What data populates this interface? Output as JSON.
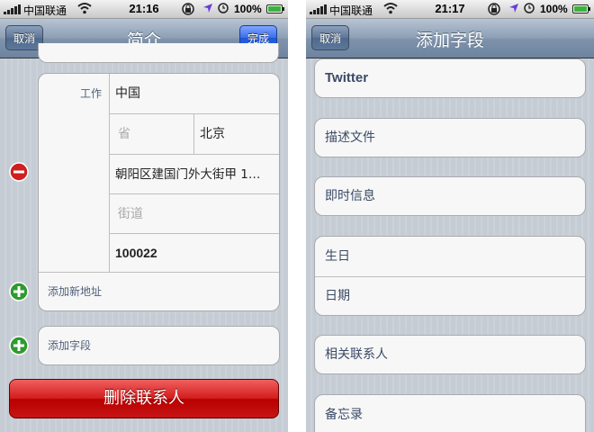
{
  "left": {
    "status": {
      "carrier": "中国联通",
      "time": "21:16",
      "battery": "100%"
    },
    "nav": {
      "cancel": "取消",
      "title": "简介",
      "done": "完成"
    },
    "address": {
      "type_label": "工作",
      "country": "中国",
      "province_placeholder": "省",
      "city": "北京",
      "street1": "朝阳区建国门外大街甲 1…",
      "street2_placeholder": "街道",
      "postcode": "100022"
    },
    "add_address": "添加新地址",
    "add_field": "添加字段",
    "delete": "删除联系人"
  },
  "right": {
    "status": {
      "carrier": "中国联通",
      "time": "21:17",
      "battery": "100%"
    },
    "nav": {
      "cancel": "取消",
      "title": "添加字段"
    },
    "fields": {
      "twitter": "Twitter",
      "profile": "描述文件",
      "im": "即时信息",
      "birthday": "生日",
      "date": "日期",
      "related": "相关联系人",
      "notes": "备忘录"
    }
  },
  "colors": {
    "delete_red": "#c71414",
    "done_blue": "#2a64e6",
    "nav_blue": "#7f93ab"
  }
}
